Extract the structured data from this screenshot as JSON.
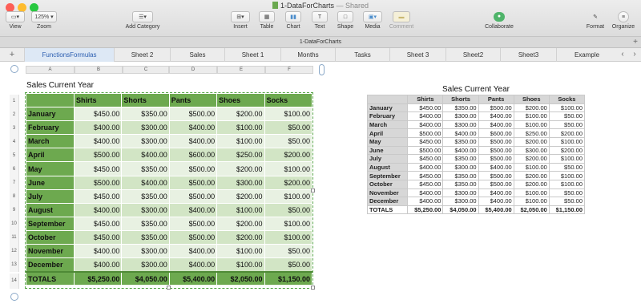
{
  "window": {
    "title": "1-DataForCharts",
    "title_suffix": "— Shared",
    "filename": "1-DataForCharts"
  },
  "colors": {
    "header_green": "#6da94f",
    "row_light": "#e8f1e2",
    "row_dark": "#d2e5c5",
    "active_tab": "#2a5db0"
  },
  "toolbar": {
    "view": {
      "label": "View",
      "icon": "sidebar-icon"
    },
    "zoom": {
      "label": "Zoom",
      "value": "125%"
    },
    "add_category": {
      "label": "Add Category",
      "icon": "list-icon"
    },
    "insert": {
      "label": "Insert",
      "icon": "plus-box-icon"
    },
    "table": {
      "label": "Table",
      "icon": "table-icon"
    },
    "chart": {
      "label": "Chart",
      "icon": "bar-chart-icon"
    },
    "text": {
      "label": "Text",
      "icon": "text-icon"
    },
    "shape": {
      "label": "Shape",
      "icon": "square-icon"
    },
    "media": {
      "label": "Media",
      "icon": "image-icon"
    },
    "comment": {
      "label": "Comment",
      "icon": "comment-icon"
    },
    "collaborate": {
      "label": "Collaborate",
      "icon": "people-icon"
    },
    "format": {
      "label": "Format",
      "icon": "paintbrush-icon"
    },
    "organize": {
      "label": "Organize",
      "icon": "filter-icon"
    }
  },
  "tabs": [
    "FunctionsFormulas",
    "Sheet 2",
    "Sales",
    "Sheet 1",
    "Months",
    "Tasks",
    "Sheet 3",
    "Sheet2",
    "Sheet3",
    "Example"
  ],
  "columns": [
    "A",
    "B",
    "C",
    "D",
    "E",
    "F"
  ],
  "row_numbers": [
    "1",
    "2",
    "3",
    "4",
    "5",
    "6",
    "7",
    "8",
    "9",
    "10",
    "11",
    "12",
    "13",
    "14"
  ],
  "main_table": {
    "title": "Sales Current Year",
    "headers": [
      "",
      "Shirts",
      "Shorts",
      "Pants",
      "Shoes",
      "Socks"
    ],
    "rows": [
      {
        "label": "January",
        "values": [
          "$450.00",
          "$350.00",
          "$500.00",
          "$200.00",
          "$100.00"
        ]
      },
      {
        "label": "February",
        "values": [
          "$400.00",
          "$300.00",
          "$400.00",
          "$100.00",
          "$50.00"
        ]
      },
      {
        "label": "March",
        "values": [
          "$400.00",
          "$300.00",
          "$400.00",
          "$100.00",
          "$50.00"
        ]
      },
      {
        "label": "April",
        "values": [
          "$500.00",
          "$400.00",
          "$600.00",
          "$250.00",
          "$200.00"
        ]
      },
      {
        "label": "May",
        "values": [
          "$450.00",
          "$350.00",
          "$500.00",
          "$200.00",
          "$100.00"
        ]
      },
      {
        "label": "June",
        "values": [
          "$500.00",
          "$400.00",
          "$500.00",
          "$300.00",
          "$200.00"
        ]
      },
      {
        "label": "July",
        "values": [
          "$450.00",
          "$350.00",
          "$500.00",
          "$200.00",
          "$100.00"
        ]
      },
      {
        "label": "August",
        "values": [
          "$400.00",
          "$300.00",
          "$400.00",
          "$100.00",
          "$50.00"
        ]
      },
      {
        "label": "September",
        "values": [
          "$450.00",
          "$350.00",
          "$500.00",
          "$200.00",
          "$100.00"
        ]
      },
      {
        "label": "October",
        "values": [
          "$450.00",
          "$350.00",
          "$500.00",
          "$200.00",
          "$100.00"
        ]
      },
      {
        "label": "November",
        "values": [
          "$400.00",
          "$300.00",
          "$400.00",
          "$100.00",
          "$50.00"
        ]
      },
      {
        "label": "December",
        "values": [
          "$400.00",
          "$300.00",
          "$400.00",
          "$100.00",
          "$50.00"
        ]
      }
    ],
    "totals": {
      "label": "TOTALS",
      "values": [
        "$5,250.00",
        "$4,050.00",
        "$5,400.00",
        "$2,050.00",
        "$1,150.00"
      ]
    }
  }
}
